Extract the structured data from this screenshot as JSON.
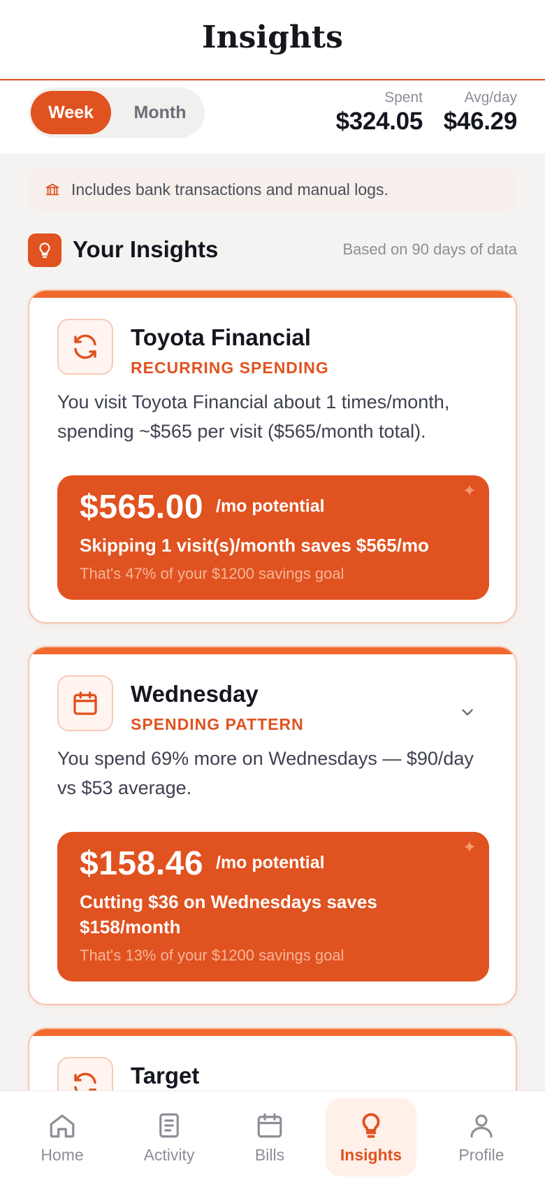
{
  "header": {
    "title": "Insights"
  },
  "period_toggle": {
    "week": "Week",
    "month": "Month",
    "selected": "Week"
  },
  "stats": {
    "spent_label": "Spent",
    "spent_value": "$324.05",
    "avg_label": "Avg/day",
    "avg_value": "$46.29"
  },
  "info_banner": {
    "icon": "bank-icon",
    "text": "Includes bank transactions and manual logs."
  },
  "section": {
    "icon": "lightbulb-icon",
    "title": "Your Insights",
    "note": "Based on 90 days of data"
  },
  "insights": [
    {
      "icon": "recurring-icon",
      "title": "Toyota Financial",
      "tag": "RECURRING SPENDING",
      "description": "You visit Toyota Financial about 1 times/month, spending ~$565 per visit ($565/month total).",
      "amount": "$565.00",
      "potential": "/mo potential",
      "savings_text": "Skipping 1 visit(s)/month saves $565/mo",
      "goal_text": "That's 47% of your $1200 savings goal"
    },
    {
      "icon": "calendar-icon",
      "title": "Wednesday",
      "tag": "SPENDING PATTERN",
      "description": "You spend 69% more on Wednesdays — $90/day vs $53 average.",
      "amount": "$158.46",
      "potential": "/mo potential",
      "savings_text": "Cutting $36 on Wednesdays saves $158/month",
      "goal_text": "That's 13% of your $1200 savings goal"
    },
    {
      "icon": "recurring-icon",
      "title": "Target"
    }
  ],
  "nav": {
    "items": [
      {
        "label": "Home",
        "icon": "home-icon"
      },
      {
        "label": "Activity",
        "icon": "document-icon"
      },
      {
        "label": "Bills",
        "icon": "calendar-icon"
      },
      {
        "label": "Insights",
        "icon": "lightbulb-icon"
      },
      {
        "label": "Profile",
        "icon": "user-icon"
      }
    ],
    "active": "Insights"
  },
  "colors": {
    "accent": "#e0521f",
    "accent_light": "#f2692e",
    "background": "#f4f3f2"
  }
}
